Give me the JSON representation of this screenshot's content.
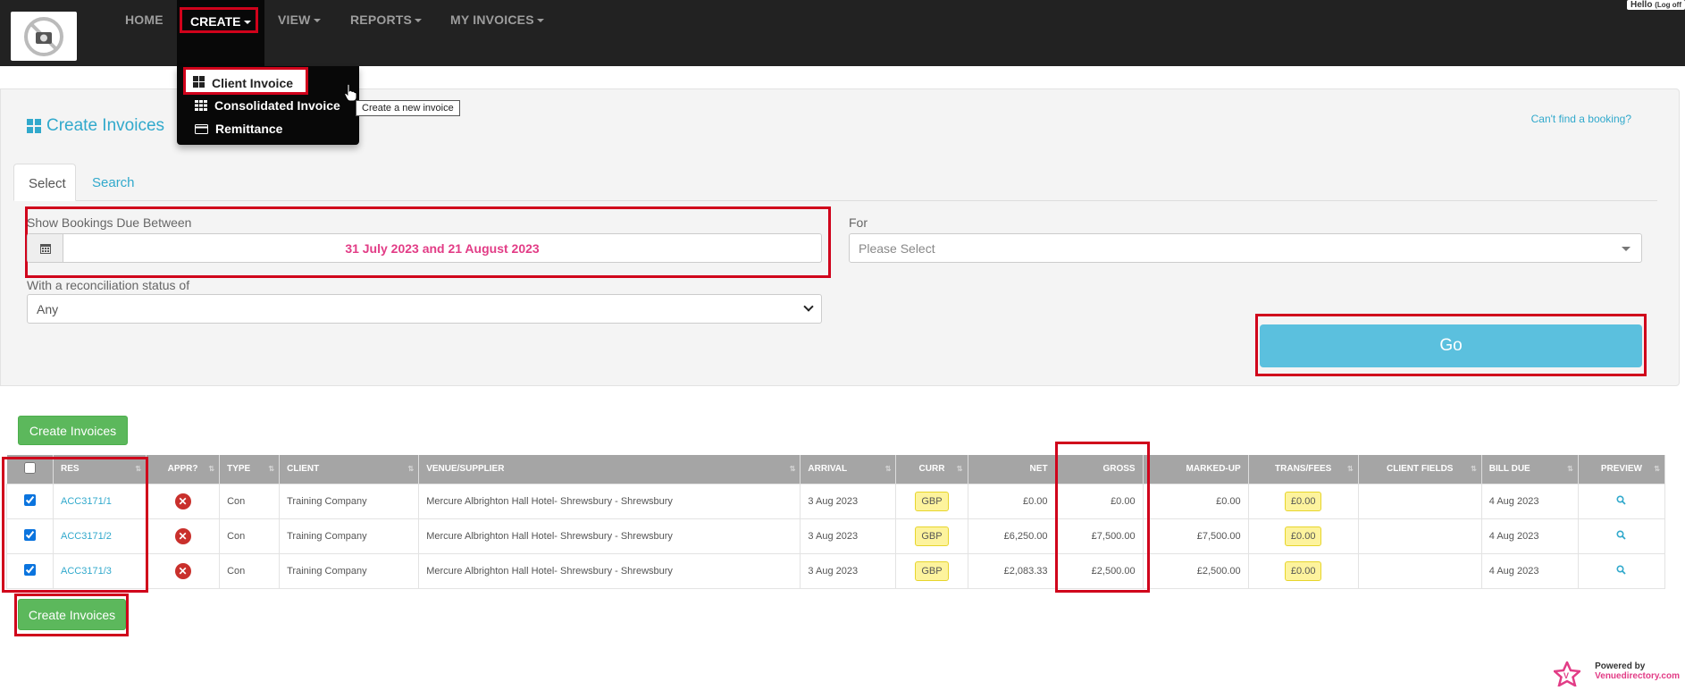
{
  "nav": {
    "home": "HOME",
    "create": "CREATE",
    "view": "VIEW",
    "reports": "REPORTS",
    "my_invoices": "MY INVOICES",
    "hello": "Hello",
    "logoff": "(Log off"
  },
  "dropdown": {
    "client_invoice": "Client Invoice",
    "consolidated_invoice": "Consolidated Invoice",
    "remittance": "Remittance",
    "tooltip": "Create a new invoice"
  },
  "panel": {
    "title": "Create Invoices",
    "cant_find": "Can't find a booking?",
    "tabs": [
      "Select",
      "Search"
    ],
    "date_label": "Show Bookings Due Between",
    "date_value": "31 July 2023 and 21 August 2023",
    "for_label": "For",
    "for_placeholder": "Please Select",
    "recon_label": "With a reconciliation status of",
    "recon_value": "Any",
    "go_label": "Go"
  },
  "create_invoices_label": "Create Invoices",
  "table": {
    "headers": [
      "RES",
      "APPR?",
      "TYPE",
      "CLIENT",
      "VENUE/SUPPLIER",
      "ARRIVAL",
      "CURR",
      "NET",
      "GROSS",
      "MARKED-UP",
      "TRANS/FEES",
      "CLIENT FIELDS",
      "BILL DUE",
      "PREVIEW"
    ],
    "rows": [
      {
        "res": "ACC3171/1",
        "type": "Con",
        "client": "Training Company",
        "venue": "Mercure Albrighton Hall Hotel- Shrewsbury - Shrewsbury",
        "arrival": "3 Aug 2023",
        "curr": "GBP",
        "net": "£0.00",
        "gross": "£0.00",
        "marked_up": "£0.00",
        "trans_fees": "£0.00",
        "client_fields": "",
        "bill_due": "4 Aug 2023"
      },
      {
        "res": "ACC3171/2",
        "type": "Con",
        "client": "Training Company",
        "venue": "Mercure Albrighton Hall Hotel- Shrewsbury - Shrewsbury",
        "arrival": "3 Aug 2023",
        "curr": "GBP",
        "net": "£6,250.00",
        "gross": "£7,500.00",
        "marked_up": "£7,500.00",
        "trans_fees": "£0.00",
        "client_fields": "",
        "bill_due": "4 Aug 2023"
      },
      {
        "res": "ACC3171/3",
        "type": "Con",
        "client": "Training Company",
        "venue": "Mercure Albrighton Hall Hotel- Shrewsbury - Shrewsbury",
        "arrival": "3 Aug 2023",
        "curr": "GBP",
        "net": "£2,083.33",
        "gross": "£2,500.00",
        "marked_up": "£2,500.00",
        "trans_fees": "£0.00",
        "client_fields": "",
        "bill_due": "4 Aug 2023"
      }
    ]
  },
  "footer": {
    "powered_by": "Powered by",
    "brand": "Venuedirectory.com"
  },
  "colors": {
    "navbar": "#222222",
    "accent": "#31a9cc",
    "go_button": "#5bc0de",
    "create_button": "#5cb85c",
    "highlight": "#d0021b",
    "date_text": "#e23c86",
    "currency_badge": "#fdf39d"
  }
}
